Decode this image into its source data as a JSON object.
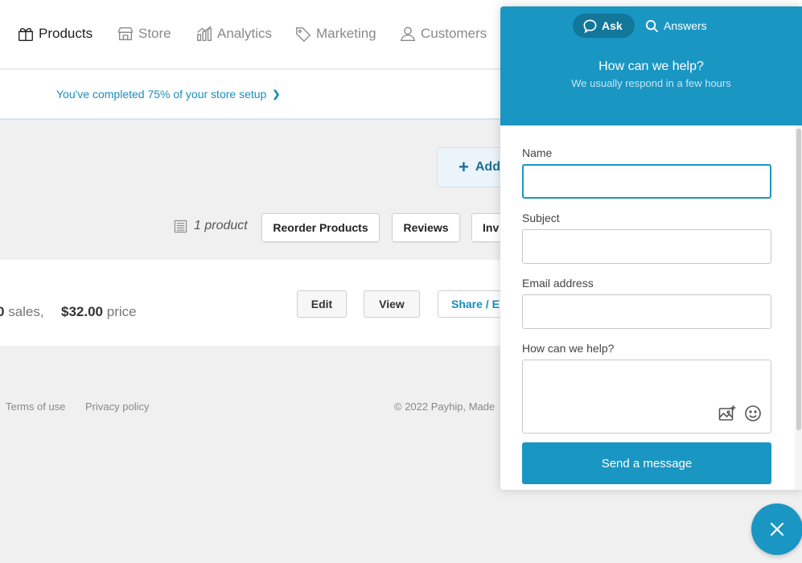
{
  "nav": {
    "items": [
      {
        "label": "Products",
        "icon": "gift-icon",
        "active": true
      },
      {
        "label": "Store",
        "icon": "store-icon",
        "active": false
      },
      {
        "label": "Analytics",
        "icon": "analytics-icon",
        "active": false
      },
      {
        "label": "Marketing",
        "icon": "tag-icon",
        "active": false
      },
      {
        "label": "Customers",
        "icon": "user-icon",
        "active": false
      }
    ]
  },
  "banner": {
    "setup_text": "You've completed 75% of your store setup",
    "setup_percent": 75
  },
  "actions": {
    "add_label": "Add"
  },
  "toolbar": {
    "product_count": "1 product",
    "reorder_label": "Reorder Products",
    "reviews_label": "Reviews",
    "inventory_label": "Inv"
  },
  "product": {
    "sales_value": "0",
    "sales_label": "sales,",
    "price_value": "$32.00",
    "price_label": "price",
    "edit_label": "Edit",
    "view_label": "View",
    "share_label": "Share / E"
  },
  "footer": {
    "terms": "Terms of use",
    "privacy": "Privacy policy",
    "copyright": "© 2022 Payhip, Made"
  },
  "widget": {
    "tabs": [
      {
        "label": "Ask",
        "icon": "chat-bubble-icon",
        "active": true
      },
      {
        "label": "Answers",
        "icon": "search-icon",
        "active": false
      }
    ],
    "title": "How can we help?",
    "subtitle": "We usually respond in a few hours",
    "fields": {
      "name_label": "Name",
      "name_value": "",
      "subject_label": "Subject",
      "subject_value": "",
      "email_label": "Email address",
      "email_value": "",
      "message_label": "How can we help?",
      "message_value": ""
    },
    "send_label": "Send a message"
  },
  "colors": {
    "accent": "#1a96c3",
    "link": "#1a8dbd",
    "background": "#f0f0f0"
  }
}
